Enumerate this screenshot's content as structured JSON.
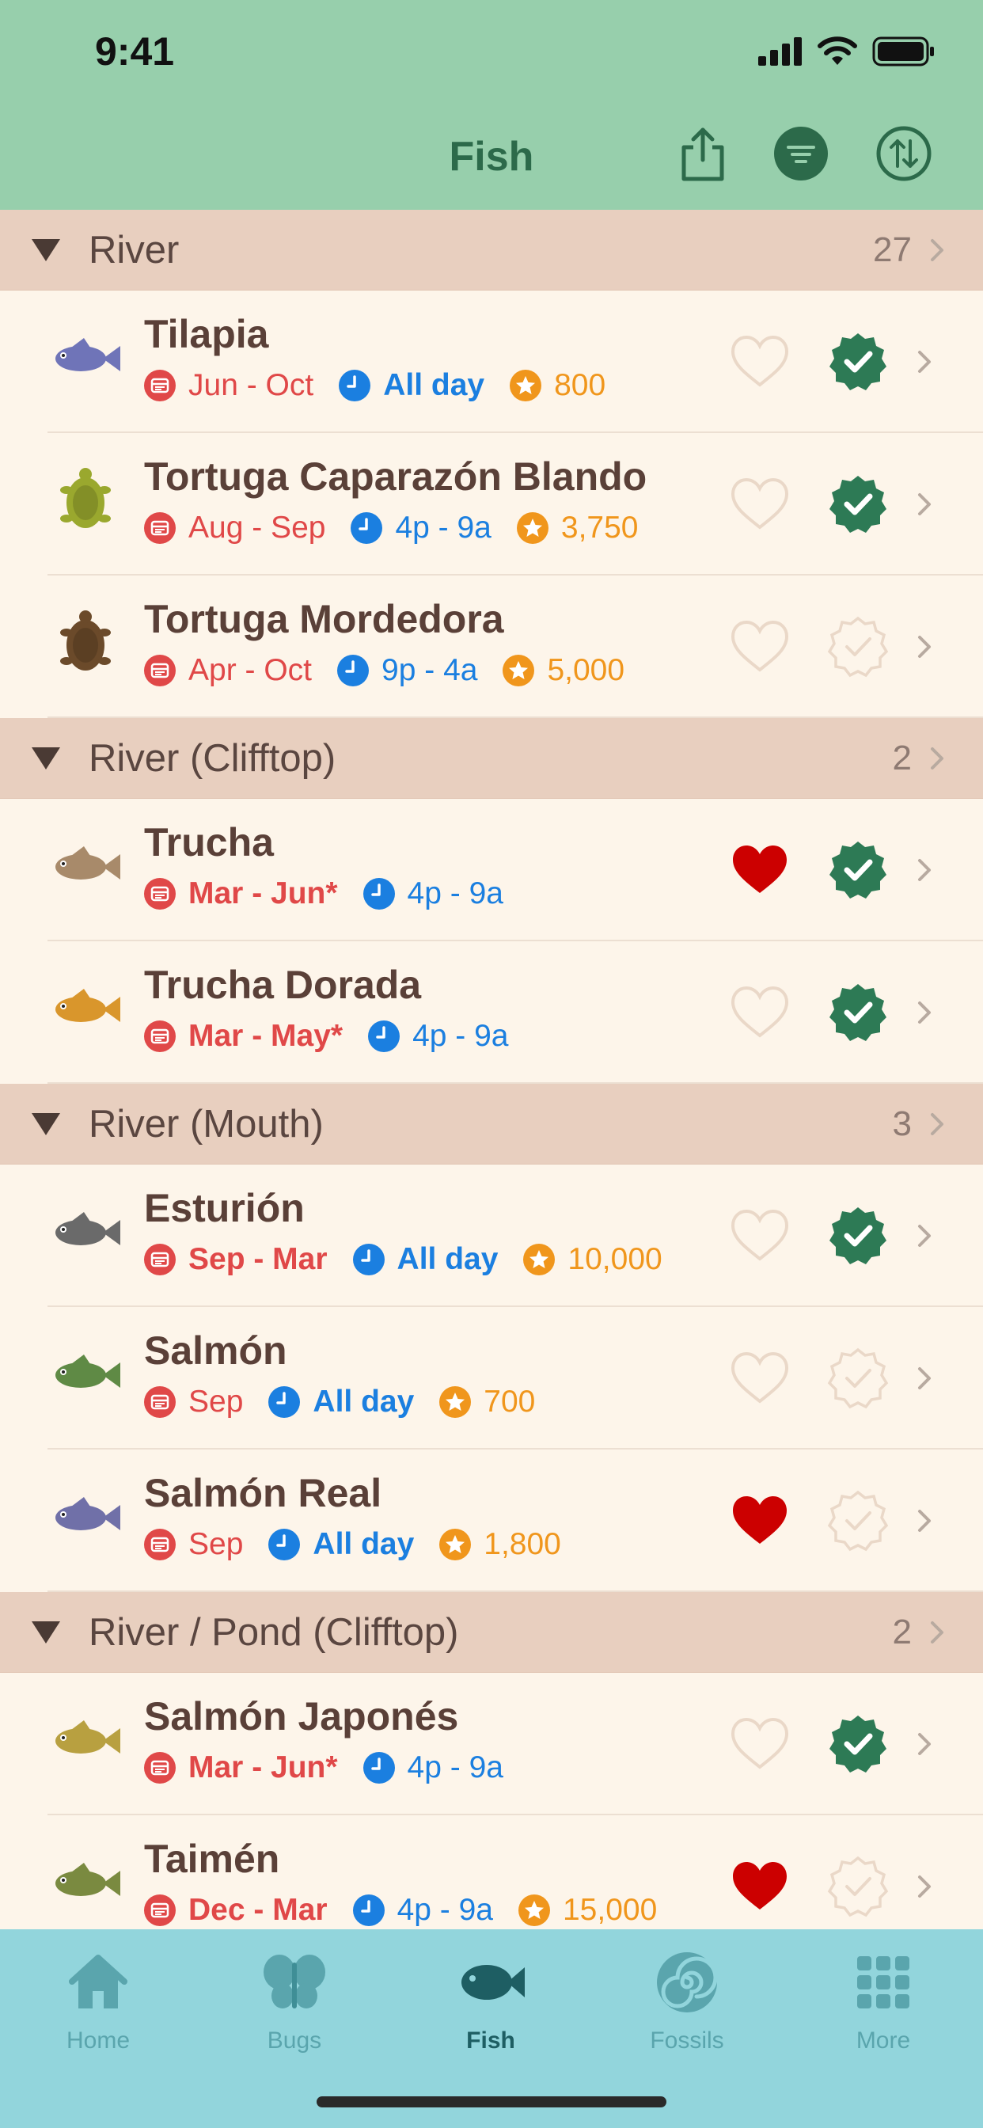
{
  "status_bar": {
    "time": "9:41"
  },
  "nav": {
    "title": "Fish"
  },
  "colors": {
    "header": "#97cfac",
    "section": "#e8cfbf",
    "row": "#fdf5ea",
    "season": "#e04848",
    "time": "#1b7fe0",
    "price": "#f0961c",
    "check": "#2d7a55",
    "heart_on": "#cc0000",
    "tabbar": "#92d5dc"
  },
  "sections": [
    {
      "title": "River",
      "count": "27",
      "rows": [
        {
          "name": "Tilapia",
          "icon": "tilapia-fish-icon",
          "season": "Jun - Oct",
          "season_bold": false,
          "time": "All day",
          "time_bold": true,
          "price": "800",
          "favorite": false,
          "caught": true
        },
        {
          "name": "Tortuga Caparazón Blando",
          "icon": "softshell-turtle-icon",
          "season": "Aug - Sep",
          "season_bold": false,
          "time": "4p - 9a",
          "time_bold": false,
          "price": "3,750",
          "favorite": false,
          "caught": true
        },
        {
          "name": "Tortuga Mordedora",
          "icon": "snapping-turtle-icon",
          "season": "Apr - Oct",
          "season_bold": false,
          "time": "9p - 4a",
          "time_bold": false,
          "price": "5,000",
          "favorite": false,
          "caught": false
        }
      ]
    },
    {
      "title": "River (Clifftop)",
      "count": "2",
      "rows": [
        {
          "name": "Trucha",
          "icon": "trout-fish-icon",
          "season": "Mar - Jun*",
          "season_bold": true,
          "time": "4p - 9a",
          "time_bold": false,
          "price": "",
          "favorite": true,
          "caught": true
        },
        {
          "name": "Trucha Dorada",
          "icon": "golden-trout-fish-icon",
          "season": "Mar - May*",
          "season_bold": true,
          "time": "4p - 9a",
          "time_bold": false,
          "price": "",
          "favorite": false,
          "caught": true
        }
      ]
    },
    {
      "title": "River (Mouth)",
      "count": "3",
      "rows": [
        {
          "name": "Esturión",
          "icon": "sturgeon-fish-icon",
          "season": "Sep - Mar",
          "season_bold": true,
          "time": "All day",
          "time_bold": true,
          "price": "10,000",
          "favorite": false,
          "caught": true
        },
        {
          "name": "Salmón",
          "icon": "salmon-fish-icon",
          "season": "Sep",
          "season_bold": false,
          "time": "All day",
          "time_bold": true,
          "price": "700",
          "favorite": false,
          "caught": false
        },
        {
          "name": "Salmón Real",
          "icon": "king-salmon-fish-icon",
          "season": "Sep",
          "season_bold": false,
          "time": "All day",
          "time_bold": true,
          "price": "1,800",
          "favorite": true,
          "caught": false
        }
      ]
    },
    {
      "title": "River / Pond (Clifftop)",
      "count": "2",
      "rows": [
        {
          "name": "Salmón Japonés",
          "icon": "cherry-salmon-fish-icon",
          "season": "Mar - Jun*",
          "season_bold": true,
          "time": "4p - 9a",
          "time_bold": false,
          "price": "",
          "favorite": false,
          "caught": true
        },
        {
          "name": "Taimén",
          "icon": "stringfish-fish-icon",
          "season": "Dec - Mar",
          "season_bold": true,
          "time": "4p - 9a",
          "time_bold": false,
          "price": "15,000",
          "favorite": true,
          "caught": false
        }
      ]
    }
  ],
  "tabs": [
    {
      "label": "Home",
      "icon": "home-icon",
      "active": false
    },
    {
      "label": "Bugs",
      "icon": "butterfly-icon",
      "active": false
    },
    {
      "label": "Fish",
      "icon": "fish-icon",
      "active": true
    },
    {
      "label": "Fossils",
      "icon": "fossil-icon",
      "active": false
    },
    {
      "label": "More",
      "icon": "grid-icon",
      "active": false
    }
  ]
}
